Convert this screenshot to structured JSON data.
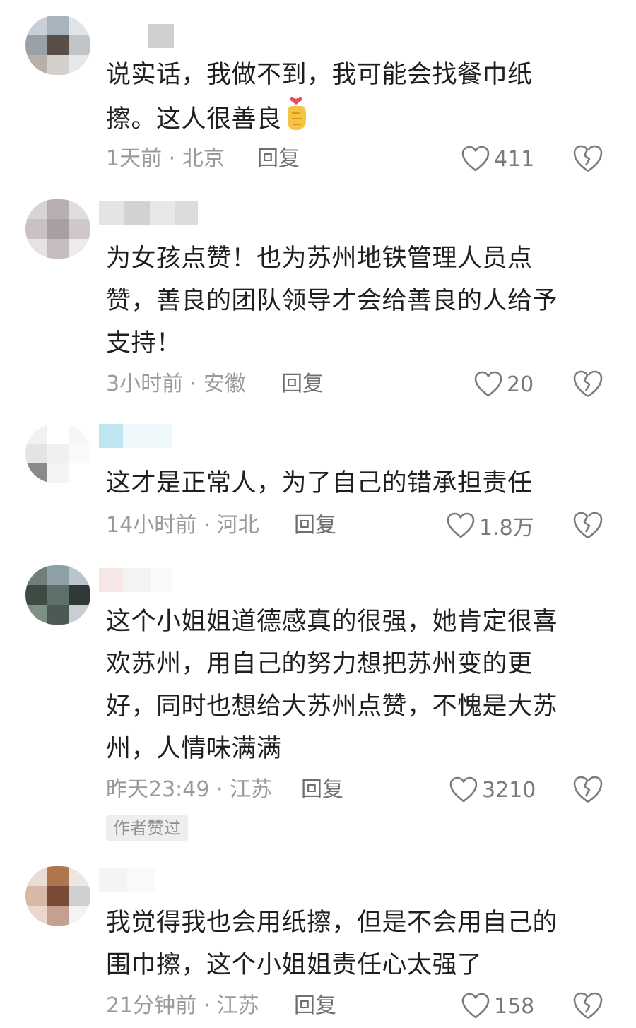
{
  "comments": [
    {
      "text": "说实话，我做不到，我可能会找餐巾纸\n擦。这人很善良",
      "time_location": "1天前 · 北京",
      "reply_label": "回复",
      "likes": "411"
    },
    {
      "text": "为女孩点赞！也为苏州地铁管理人员点\n赞，善良的团队领导才会给善良的人给予\n支持！",
      "time_location": "3小时前 · 安徽",
      "reply_label": "回复",
      "likes": "20"
    },
    {
      "text": "这才是正常人，为了自己的错承担责任",
      "time_location": "14小时前 · 河北",
      "reply_label": "回复",
      "likes": "1.8万"
    },
    {
      "text": "这个小姐姐道德感真的很强，她肯定很喜\n欢苏州，用自己的努力想把苏州变的更\n好，同时也想给大苏州点赞，不愧是大苏\n州，人情味满满",
      "time_location": "昨天23:49 · 江苏",
      "reply_label": "回复",
      "likes": "3210",
      "badge": "作者赞过"
    },
    {
      "text": "我觉得我也会用纸擦，但是不会用自己的\n围巾擦，这个小姐姐责任心太强了",
      "time_location": "21分钟前 · 江苏",
      "reply_label": "回复",
      "likes": "158"
    }
  ],
  "icons": {
    "like": "heart-outline-icon",
    "dislike": "broken-heart-icon",
    "emoji": "finger-heart-emoji"
  },
  "colors": {
    "text": "#1f1f1f",
    "meta": "#9a9a9a",
    "icon": "#7a7a7a"
  }
}
